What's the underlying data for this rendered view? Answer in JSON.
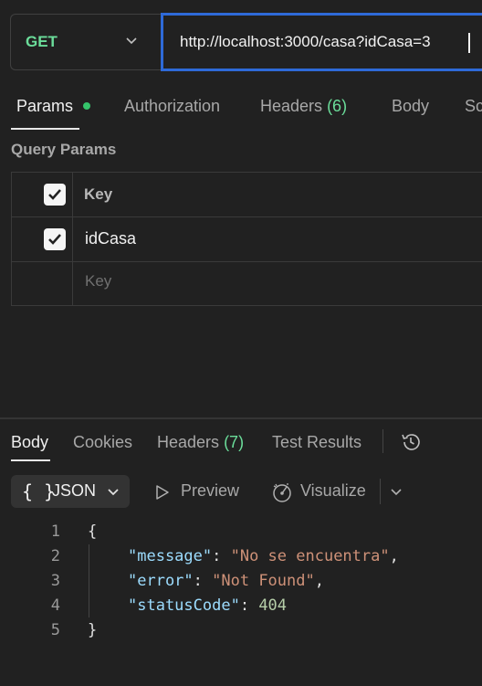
{
  "request": {
    "method": "GET",
    "url": "http://localhost:3000/casa?idCasa=3"
  },
  "request_tabs": {
    "params": "Params",
    "authorization": "Authorization",
    "headers_label": "Headers",
    "headers_count": "(6)",
    "body": "Body",
    "scripts_partial": "Sc"
  },
  "query_params": {
    "title": "Query Params",
    "header_key": "Key",
    "rows": [
      {
        "key": "idCasa",
        "checked": true
      }
    ],
    "placeholder_key": "Key"
  },
  "response_tabs": {
    "body": "Body",
    "cookies": "Cookies",
    "headers_label": "Headers",
    "headers_count": "(7)",
    "test_results": "Test Results"
  },
  "toolbar": {
    "format_braces": "{ }",
    "format": "JSON",
    "preview": "Preview",
    "visualize": "Visualize"
  },
  "response_body": {
    "line_numbers": [
      "1",
      "2",
      "3",
      "4",
      "5"
    ],
    "open_brace": "{",
    "close_brace": "}",
    "fields": [
      {
        "key": "\"message\"",
        "value": "\"No se encuentra\"",
        "type": "string",
        "trailing": ","
      },
      {
        "key": "\"error\"",
        "value": "\"Not Found\"",
        "type": "string",
        "trailing": ","
      },
      {
        "key": "\"statusCode\"",
        "value": "404",
        "type": "number",
        "trailing": ""
      }
    ]
  },
  "colors": {
    "background": "#212121",
    "method_get": "#6bdd9a",
    "url_focus_border": "#2e6ad8",
    "params_dot": "#35c46b",
    "json_key": "#9cdcfe",
    "json_string": "#ce9178",
    "json_number": "#b5cea8"
  },
  "icons": [
    "chevron-down-icon",
    "checkbox-checked-icon",
    "history-icon",
    "play-icon",
    "visualize-icon"
  ]
}
